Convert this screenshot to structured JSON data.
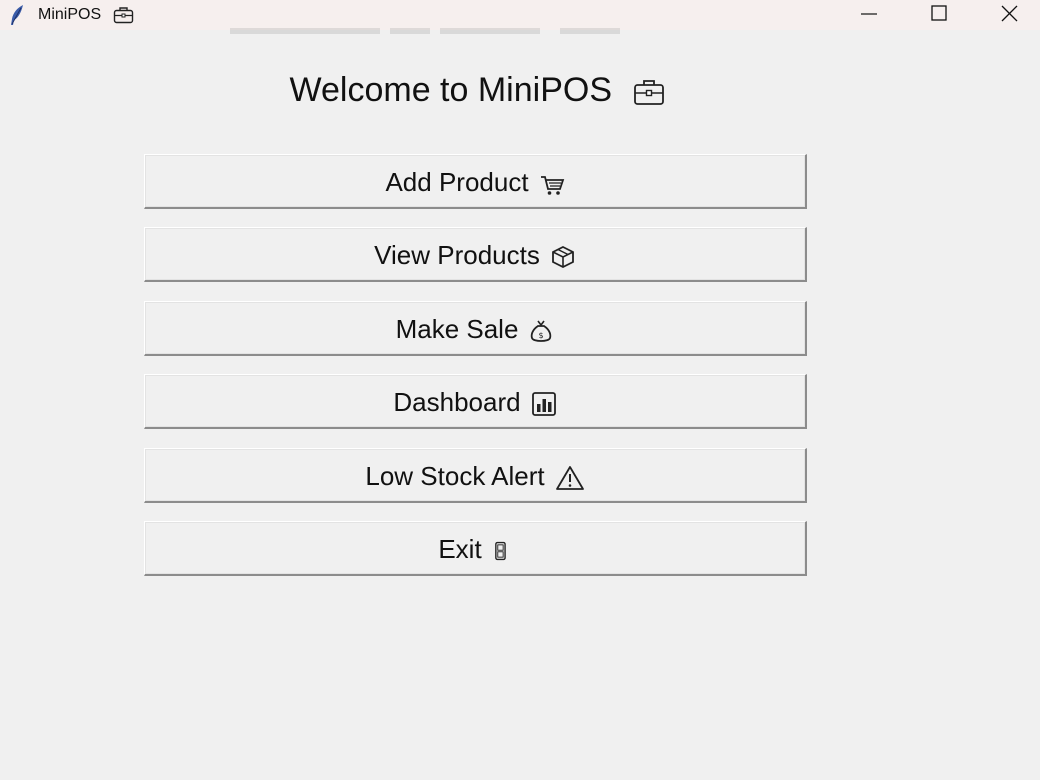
{
  "window": {
    "title": "MiniPOS",
    "title_icon": "briefcase-icon",
    "app_icon": "feather-icon",
    "controls": [
      "minimize",
      "maximize",
      "close"
    ]
  },
  "main": {
    "heading": "Welcome to MiniPOS",
    "heading_icon": "briefcase-icon",
    "buttons": [
      {
        "label": "Add Product",
        "icon": "shopping-cart-icon"
      },
      {
        "label": "View Products",
        "icon": "package-box-icon"
      },
      {
        "label": "Make Sale",
        "icon": "money-bag-icon"
      },
      {
        "label": "Dashboard",
        "icon": "bar-chart-icon"
      },
      {
        "label": "Low Stock Alert",
        "icon": "warning-icon"
      },
      {
        "label": "Exit",
        "icon": "door-icon"
      }
    ]
  },
  "colors": {
    "background": "#f0f0f0",
    "titlebar": "#f6efee",
    "text": "#111111"
  }
}
